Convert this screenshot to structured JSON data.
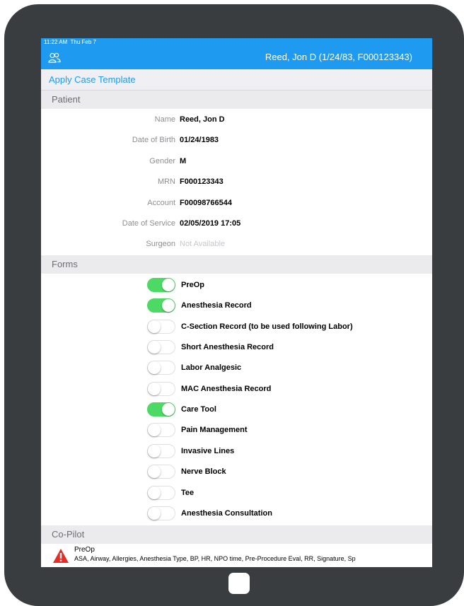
{
  "status_bar": {
    "time": "11:22 AM",
    "day": "Thu Feb 7"
  },
  "nav": {
    "icon": "patients-icon",
    "title": "Reed, Jon D (1/24/83, F000123343)"
  },
  "apply_case_template": "Apply Case Template",
  "patient_section": {
    "header": "Patient",
    "fields": [
      {
        "label": "Name",
        "value": "Reed, Jon D"
      },
      {
        "label": "Date of Birth",
        "value": "01/24/1983"
      },
      {
        "label": "Gender",
        "value": "M"
      },
      {
        "label": "MRN",
        "value": "F000123343"
      },
      {
        "label": "Account",
        "value": "F00098766544"
      },
      {
        "label": "Date of Service",
        "value": "02/05/2019 17:05"
      },
      {
        "label": "Surgeon",
        "value": "Not Available"
      }
    ]
  },
  "forms_section": {
    "header": "Forms",
    "items": [
      {
        "label": "PreOp",
        "on": true
      },
      {
        "label": "Anesthesia Record",
        "on": true
      },
      {
        "label": "C-Section Record (to be used following Labor)",
        "on": false
      },
      {
        "label": "Short Anesthesia Record",
        "on": false
      },
      {
        "label": "Labor Analgesic",
        "on": false
      },
      {
        "label": "MAC Anesthesia Record",
        "on": false
      },
      {
        "label": "Care Tool",
        "on": true
      },
      {
        "label": "Pain Management",
        "on": false
      },
      {
        "label": "Invasive Lines",
        "on": false
      },
      {
        "label": "Nerve Block",
        "on": false
      },
      {
        "label": "Tee",
        "on": false
      },
      {
        "label": "Anesthesia Consultation",
        "on": false
      }
    ]
  },
  "copilot_section": {
    "header": "Co-Pilot",
    "alert": {
      "icon": "warning-icon",
      "title": "PreOp",
      "detail": "ASA, Airway, Allergies, Anesthesia Type, BP, HR, NPO time, Pre-Procedure Eval, RR, Signature, Sp"
    }
  },
  "colors": {
    "accent": "#1e9bf0",
    "toggle_on": "#4cd964",
    "section_bg": "#ebebee",
    "device_frame": "#3a3d40",
    "warning": "#e52d27"
  }
}
